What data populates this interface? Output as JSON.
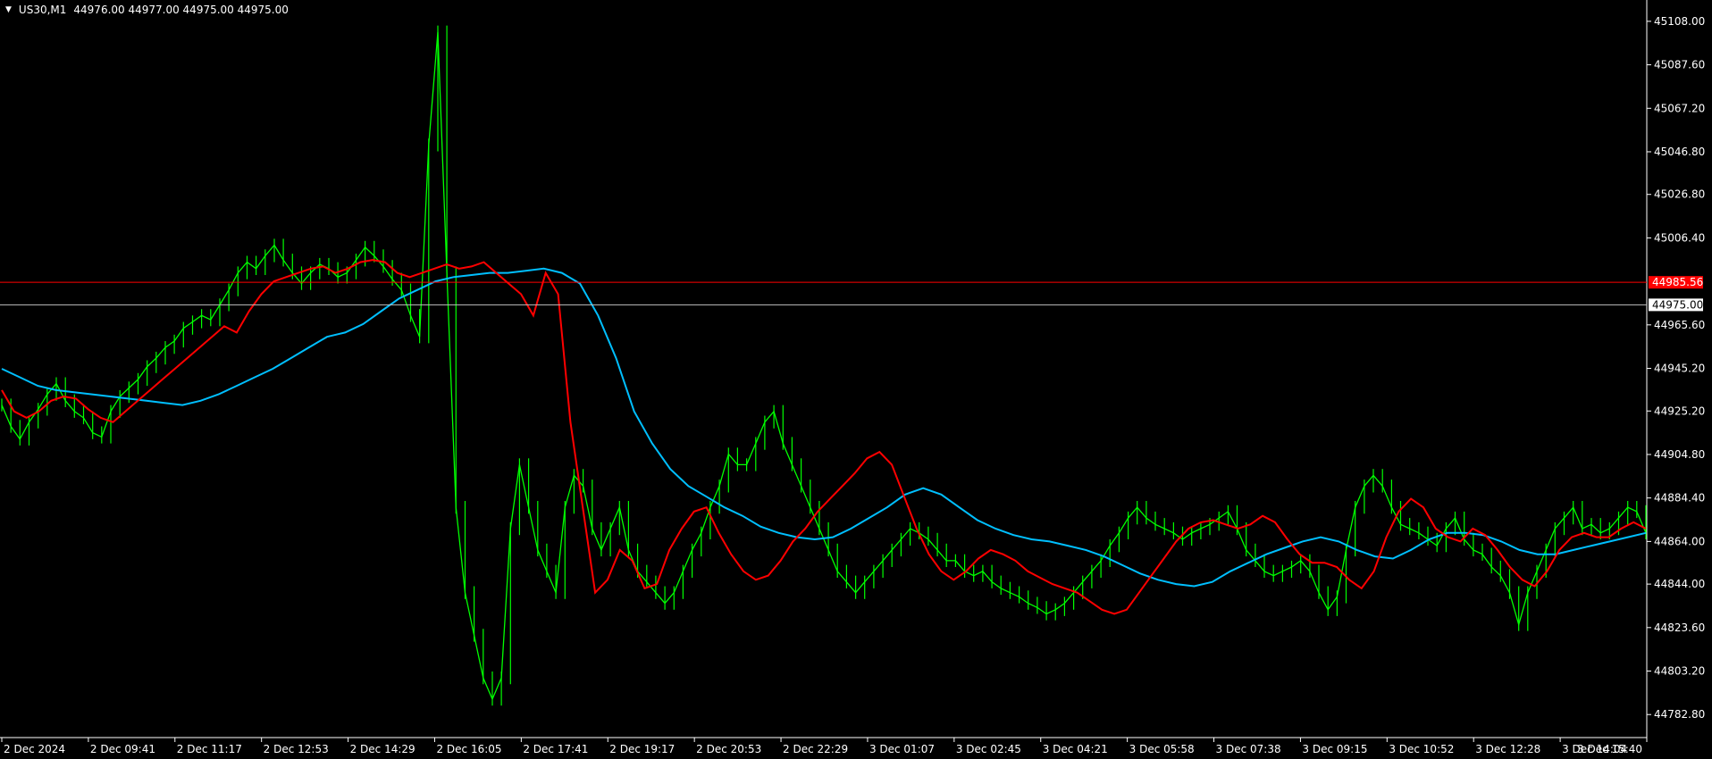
{
  "header": {
    "symbol": "US30,M1",
    "ohlc": "44976.00 44977.00 44975.00 44975.00"
  },
  "colors": {
    "background": "#000000",
    "candles": "#00ff00",
    "ma_fast": "#ff0000",
    "ma_slow": "#00bfff",
    "level_line": "#ff0000",
    "bid_line": "#c0c0c0"
  },
  "chart_data": {
    "type": "line",
    "title": "",
    "ylim": [
      44772.0,
      45118.0
    ],
    "price_ticks": [
      "45108.00",
      "45087.60",
      "45067.20",
      "45046.80",
      "45026.80",
      "45006.40",
      "44965.60",
      "44945.20",
      "44925.20",
      "44904.80",
      "44884.40",
      "44864.00",
      "44844.00",
      "44823.60",
      "44803.20",
      "44782.80"
    ],
    "time_ticks": [
      "2 Dec 2024",
      "2 Dec 09:41",
      "2 Dec 11:17",
      "2 Dec 12:53",
      "2 Dec 14:29",
      "2 Dec 16:05",
      "2 Dec 17:41",
      "2 Dec 19:17",
      "2 Dec 20:53",
      "2 Dec 22:29",
      "3 Dec 01:07",
      "3 Dec 02:45",
      "3 Dec 04:21",
      "3 Dec 05:58",
      "3 Dec 07:38",
      "3 Dec 09:15",
      "3 Dec 10:52",
      "3 Dec 12:28",
      "3 Dec 14:04",
      "3 Dec 15:40"
    ],
    "level_line": {
      "value": 44985.56,
      "label": "44985.56"
    },
    "bid_line": {
      "value": 44975.0,
      "label": "44975.00"
    },
    "series": [
      {
        "kind": "price",
        "values": [
          44928,
          44918,
          44912,
          44920,
          44926,
          44933,
          44938,
          44930,
          44925,
          44922,
          44915,
          44913,
          44925,
          44932,
          44936,
          44940,
          44946,
          44950,
          44955,
          44958,
          44964,
          44967,
          44970,
          44968,
          44975,
          44982,
          44990,
          44995,
          44992,
          44998,
          45003,
          44996,
          44990,
          44985,
          44990,
          44994,
          44992,
          44988,
          44990,
          44996,
          45002,
          44998,
          44993,
          44987,
          44982,
          44970,
          44960,
          45050,
          45103,
          44990,
          44880,
          44840,
          44820,
          44800,
          44790,
          44800,
          44870,
          44900,
          44880,
          44860,
          44850,
          44840,
          44880,
          44895,
          44890,
          44870,
          44860,
          44870,
          44880,
          44860,
          44850,
          44845,
          44840,
          44835,
          44840,
          44850,
          44860,
          44868,
          44880,
          44890,
          44905,
          44900,
          44900,
          44910,
          44920,
          44925,
          44910,
          44900,
          44890,
          44880,
          44870,
          44860,
          44850,
          44845,
          44840,
          44845,
          44850,
          44855,
          44860,
          44865,
          44870,
          44868,
          44865,
          44860,
          44855,
          44855,
          44850,
          44848,
          44850,
          44845,
          44842,
          44840,
          44838,
          44835,
          44833,
          44830,
          44832,
          44835,
          44840,
          44845,
          44850,
          44855,
          44862,
          44868,
          44875,
          44880,
          44875,
          44872,
          44870,
          44868,
          44865,
          44868,
          44870,
          44872,
          44875,
          44878,
          44870,
          44860,
          44855,
          44850,
          44848,
          44850,
          44852,
          44855,
          44850,
          44840,
          44832,
          44838,
          44860,
          44880,
          44890,
          44895,
          44890,
          44880,
          44872,
          44870,
          44868,
          44865,
          44862,
          44870,
          44875,
          44865,
          44860,
          44858,
          44852,
          44848,
          44840,
          44825,
          44840,
          44850,
          44860,
          44870,
          44875,
          44880,
          44870,
          44872,
          44868,
          44870,
          44875,
          44880,
          44878,
          44868
        ]
      },
      {
        "kind": "ma_fast",
        "values": [
          44935,
          44925,
          44922,
          44925,
          44930,
          44932,
          44931,
          44926,
          44922,
          44920,
          44925,
          44930,
          44935,
          44940,
          44945,
          44950,
          44955,
          44960,
          44965,
          44962,
          44972,
          44980,
          44986,
          44988,
          44990,
          44992,
          44993,
          44990,
          44992,
          44995,
          44996,
          44995,
          44990,
          44988,
          44990,
          44992,
          44994,
          44992,
          44993,
          44995,
          44990,
          44985,
          44980,
          44970,
          44990,
          44980,
          44920,
          44880,
          44840,
          44846,
          44860,
          44855,
          44842,
          44844,
          44860,
          44870,
          44878,
          44880,
          44868,
          44858,
          44850,
          44846,
          44848,
          44855,
          44864,
          44870,
          44878,
          44884,
          44890,
          44896,
          44903,
          44906,
          44900,
          44885,
          44870,
          44858,
          44850,
          44846,
          44850,
          44856,
          44860,
          44858,
          44855,
          44850,
          44847,
          44844,
          44842,
          44840,
          44836,
          44832,
          44830,
          44832,
          44840,
          44848,
          44856,
          44864,
          44870,
          44873,
          44874,
          44872,
          44870,
          44872,
          44876,
          44873,
          44865,
          44858,
          44854,
          44854,
          44852,
          44846,
          44842,
          44850,
          44866,
          44878,
          44884,
          44880,
          44870,
          44866,
          44864,
          44870,
          44867,
          44860,
          44852,
          44846,
          44843,
          44850,
          44860,
          44866,
          44868,
          44866,
          44866,
          44870,
          44873,
          44870
        ]
      },
      {
        "kind": "ma_slow",
        "values": [
          44945,
          44941,
          44937,
          44935,
          44934,
          44933,
          44932,
          44931,
          44930,
          44929,
          44928,
          44930,
          44933,
          44937,
          44941,
          44945,
          44950,
          44955,
          44960,
          44962,
          44966,
          44972,
          44978,
          44982,
          44986,
          44988,
          44989,
          44990,
          44990,
          44991,
          44992,
          44990,
          44985,
          44970,
          44950,
          44925,
          44910,
          44898,
          44890,
          44885,
          44880,
          44876,
          44871,
          44868,
          44866,
          44865,
          44866,
          44870,
          44875,
          44880,
          44886,
          44889,
          44886,
          44880,
          44874,
          44870,
          44867,
          44865,
          44864,
          44862,
          44860,
          44857,
          44853,
          44849,
          44846,
          44844,
          44843,
          44845,
          44850,
          44854,
          44858,
          44861,
          44864,
          44866,
          44864,
          44860,
          44857,
          44856,
          44860,
          44865,
          44868,
          44868,
          44867,
          44864,
          44860,
          44858,
          44858,
          44860,
          44862,
          44864,
          44866,
          44868
        ]
      }
    ]
  }
}
